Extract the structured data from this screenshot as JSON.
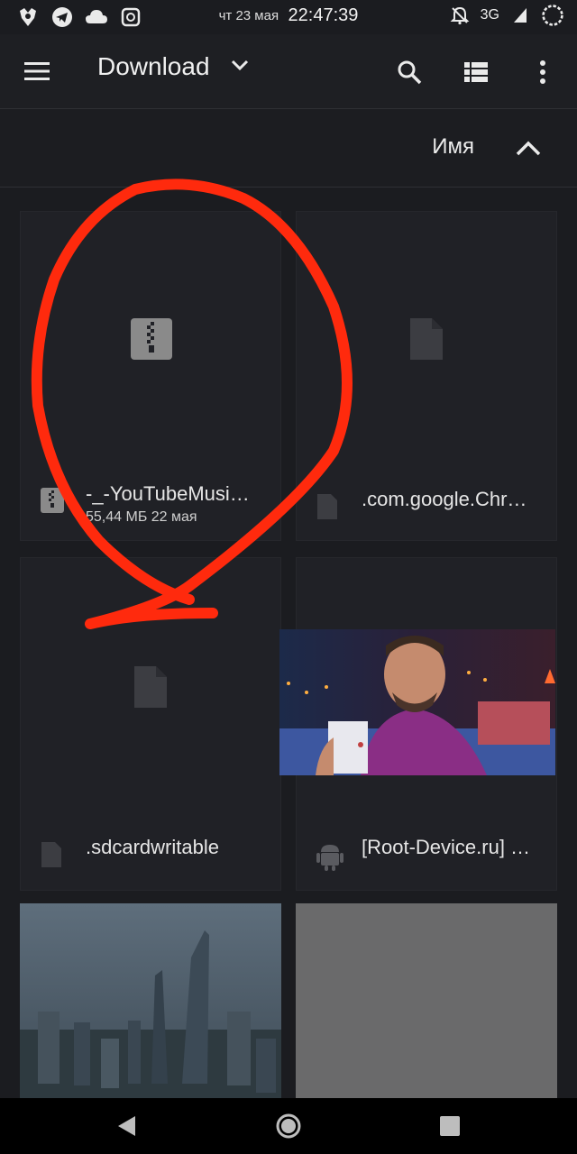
{
  "status_bar": {
    "date": "чт 23 мая",
    "time": "22:47:39",
    "network": "3G",
    "left_icons": [
      "app-icon",
      "telegram-icon",
      "cloud-icon",
      "screenshot-icon"
    ],
    "right_icons": [
      "bell-off-icon",
      "signal-icon",
      "battery-ring-icon"
    ]
  },
  "app_bar": {
    "title": "Download",
    "icons": [
      "menu-icon",
      "chevron-down-icon",
      "search-icon",
      "list-view-icon",
      "more-vert-icon"
    ]
  },
  "sort_bar": {
    "label": "Имя",
    "direction_icon": "chevron-up-icon"
  },
  "files": [
    {
      "name": "-_-YouTubeMusi…",
      "size": "55,44 МБ",
      "date": "22 мая",
      "icon": "zip-icon"
    },
    {
      "name": ".com.google.Chr…",
      "icon": "file-icon"
    },
    {
      "name": ".sdcardwritable",
      "icon": "file-icon"
    },
    {
      "name": "[Root-Device.ru] …",
      "icon": "android-icon",
      "thumbnail": "video-thumbnail"
    },
    {
      "name": "",
      "thumbnail": "city-photo-thumbnail"
    },
    {
      "name": "",
      "thumbnail": "gray-placeholder"
    }
  ],
  "annotation": {
    "shape": "hand-drawn red circle",
    "color": "#ff2a0d"
  },
  "nav_bar": {
    "icons": [
      "back-icon",
      "home-icon",
      "recents-icon"
    ]
  }
}
